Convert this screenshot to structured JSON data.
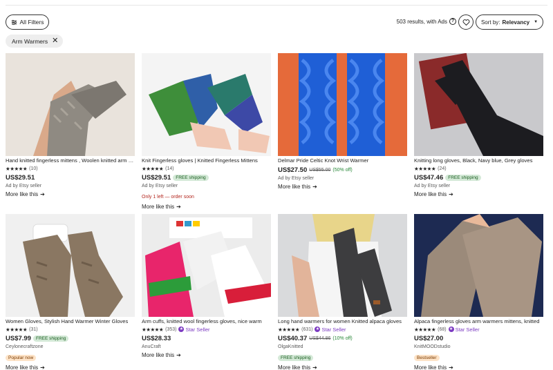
{
  "toolbar": {
    "all_filters": "All Filters",
    "results_text": "503 results, with Ads",
    "sort_label": "Sort by:",
    "sort_value": "Relevancy"
  },
  "active_filter": "Arm Warmers",
  "more_like_this": "More like this",
  "colors": {
    "star_seller": "#7b39c1",
    "free_shipping_bg": "#d4e9d7",
    "bestseller_bg": "#fde3c7"
  },
  "listings": [
    {
      "title": "Hand knitted fingerless mittens , Woolen knitted arm warmers",
      "stars": "★★★★★",
      "reviews": "(10)",
      "price": "US$29.51",
      "seller": "Ad by Etsy seller",
      "more": "More like this"
    },
    {
      "title": "Knit Fingerless gloves | Knitted Fingerless Mittens",
      "stars": "★★★★★",
      "reviews": "(14)",
      "price": "US$29.51",
      "shipping": "FREE shipping",
      "seller": "Ad by Etsy seller",
      "urgency": "Only 1 left — order soon",
      "more": "More like this"
    },
    {
      "title": "Delmar Pride Celtic Knot Wrist Warmer",
      "price": "US$27.50",
      "old_price": "US$55.00",
      "discount": "(50% off)",
      "seller": "Ad by Etsy seller",
      "more": "More like this"
    },
    {
      "title": "Knitting long gloves, Black, Navy blue, Grey gloves",
      "stars": "★★★★★",
      "reviews": "(24)",
      "price": "US$47.46",
      "shipping": "FREE shipping",
      "seller": "Ad by Etsy seller",
      "more": "More like this"
    },
    {
      "title": "Women Gloves, Stylish Hand Warmer Winter Gloves",
      "stars": "★★★★★",
      "reviews": "(31)",
      "price": "US$7.99",
      "shipping": "FREE shipping",
      "seller": "Ceylonecraftzone",
      "badge": "Popular now",
      "more": "More like this"
    },
    {
      "title": "Arm cuffs, knitted wool fingerless gloves, nice warm",
      "stars": "★★★★★",
      "reviews": "(353)",
      "star_seller": "Star Seller",
      "price": "US$28.33",
      "seller": "AnuCraft",
      "more": "More like this"
    },
    {
      "title": "Long hand warmers for women Knitted alpaca gloves",
      "stars": "★★★★★",
      "reviews": "(631)",
      "star_seller": "Star Seller",
      "price": "US$40.37",
      "old_price": "US$44.86",
      "discount": "(10% off)",
      "seller": "OlgaKnitted",
      "badge": "FREE shipping",
      "more": "More like this"
    },
    {
      "title": "Alpaca fingerless gloves arm warmers mittens, knitted",
      "stars": "★★★★★",
      "reviews": "(68)",
      "star_seller": "Star Seller",
      "price": "US$27.00",
      "seller": "KnitMOODstudio",
      "badge": "Bestseller",
      "more": "More like this"
    }
  ]
}
